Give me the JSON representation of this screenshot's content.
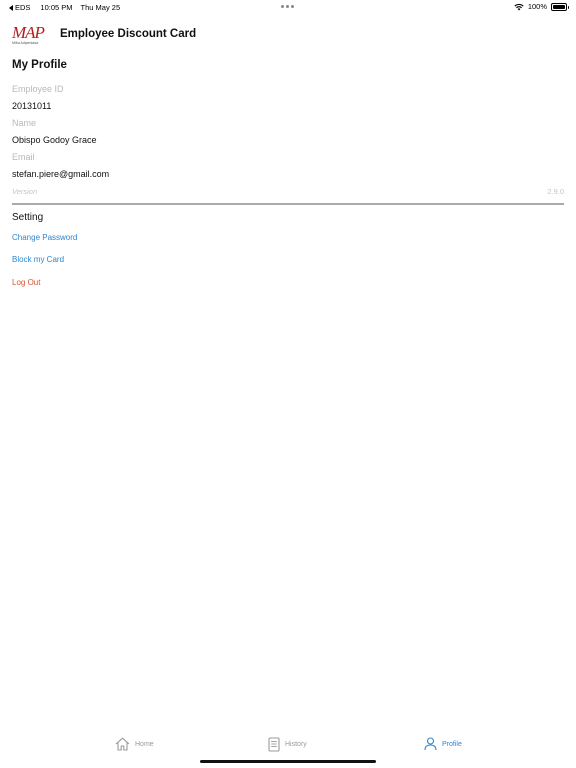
{
  "status_bar": {
    "back_app": "EDS",
    "time": "10:05 PM",
    "date": "Thu May 25",
    "battery": "100%",
    "battery_level": 1.0
  },
  "header": {
    "logo_text": "MAP",
    "logo_sub": "Mitra Adiperkasa",
    "title": "Employee Discount Card"
  },
  "profile": {
    "title": "My Profile",
    "fields": [
      {
        "label": "Employee ID",
        "value": "20131011"
      },
      {
        "label": "Name",
        "value": "Obispo Godoy Grace"
      },
      {
        "label": "Email",
        "value": "stefan.piere@gmail.com"
      }
    ],
    "version_label": "Version",
    "version_value": "2.9.0"
  },
  "setting": {
    "title": "Setting",
    "links": [
      {
        "label": "Change Password"
      },
      {
        "label": "Block my Card"
      },
      {
        "label": "Log Out"
      }
    ]
  },
  "tabs": [
    {
      "label": "Home",
      "icon": "home-icon",
      "active": false
    },
    {
      "label": "History",
      "icon": "document-icon",
      "active": false
    },
    {
      "label": "Profile",
      "icon": "person-icon",
      "active": true
    }
  ],
  "colors": {
    "accent": "#2a86d1",
    "logout": "#d9532d",
    "brand": "#b51b1b"
  }
}
